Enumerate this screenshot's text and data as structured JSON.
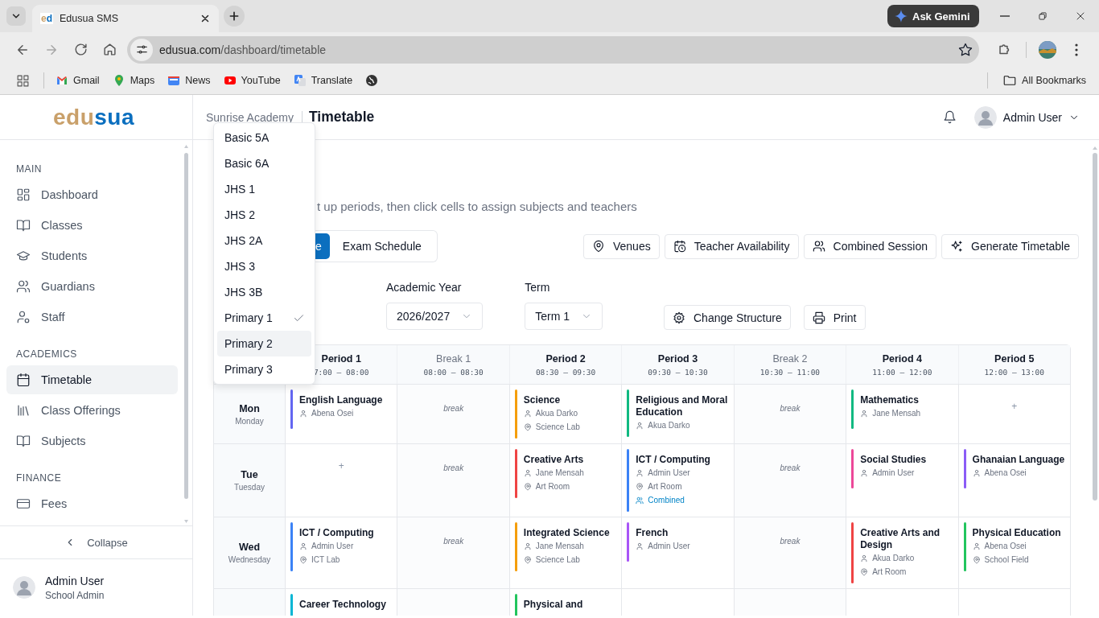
{
  "browser": {
    "tab": {
      "favicon_first": "e",
      "favicon_second": "d",
      "title": "Edusua SMS"
    },
    "ask_gemini": "Ask Gemini",
    "url_host": "edusua.com",
    "url_path": "/dashboard/timetable",
    "bookmarks": [
      "Gmail",
      "Maps",
      "News",
      "YouTube",
      "Translate"
    ],
    "all_bookmarks": "All Bookmarks"
  },
  "sidebar": {
    "logo_first": "edu",
    "logo_second": "sua",
    "sections": [
      {
        "title": "MAIN",
        "items": [
          {
            "label": "Dashboard",
            "selected": false
          },
          {
            "label": "Classes",
            "selected": false
          },
          {
            "label": "Students",
            "selected": false
          },
          {
            "label": "Guardians",
            "selected": false
          },
          {
            "label": "Staff",
            "selected": false
          }
        ]
      },
      {
        "title": "ACADEMICS",
        "items": [
          {
            "label": "Timetable",
            "selected": true
          },
          {
            "label": "Class Offerings",
            "selected": false
          },
          {
            "label": "Subjects",
            "selected": false
          }
        ]
      },
      {
        "title": "FINANCE",
        "items": [
          {
            "label": "Fees",
            "selected": false
          }
        ]
      }
    ],
    "collapse": "Collapse",
    "user": {
      "name": "Admin User",
      "role": "School Admin"
    }
  },
  "header": {
    "school": "Sunrise Academy",
    "page": "Timetable",
    "user": "Admin User"
  },
  "subtitle": "t up periods, then click cells to assign subjects and teachers",
  "view_tabs": [
    {
      "label": "e",
      "selected": true
    },
    {
      "label": "Exam Schedule",
      "selected": false
    }
  ],
  "actions": [
    "Venues",
    "Teacher Availability",
    "Combined Session",
    "Generate Timetable"
  ],
  "filters": [
    {
      "label": "Academic Year",
      "value": "2026/2027"
    },
    {
      "label": "Term",
      "value": "Term 1"
    }
  ],
  "tools": [
    "Change Structure",
    "Print"
  ],
  "class_dropdown": [
    {
      "label": "Basic 5A",
      "checked": false,
      "highlighted": false
    },
    {
      "label": "Basic 6A",
      "checked": false,
      "highlighted": false
    },
    {
      "label": "JHS 1",
      "checked": false,
      "highlighted": false
    },
    {
      "label": "JHS 2",
      "checked": false,
      "highlighted": false
    },
    {
      "label": "JHS 2A",
      "checked": false,
      "highlighted": false
    },
    {
      "label": "JHS 3",
      "checked": false,
      "highlighted": false
    },
    {
      "label": "JHS 3B",
      "checked": false,
      "highlighted": false
    },
    {
      "label": "Primary 1",
      "checked": true,
      "highlighted": false
    },
    {
      "label": "Primary 2",
      "checked": false,
      "highlighted": true
    },
    {
      "label": "Primary 3",
      "checked": false,
      "highlighted": false
    }
  ],
  "timetable": {
    "columns": [
      {
        "kind": "period",
        "name": "Period 1",
        "time": "7:00 – 08:00"
      },
      {
        "kind": "break",
        "name": "Break 1",
        "time": "08:00 – 08:30"
      },
      {
        "kind": "period",
        "name": "Period 2",
        "time": "08:30 – 09:30"
      },
      {
        "kind": "period",
        "name": "Period 3",
        "time": "09:30 – 10:30"
      },
      {
        "kind": "break",
        "name": "Break 2",
        "time": "10:30 – 11:00"
      },
      {
        "kind": "period",
        "name": "Period 4",
        "time": "11:00 – 12:00"
      },
      {
        "kind": "period",
        "name": "Period 5",
        "time": "12:00 – 13:00"
      }
    ],
    "rows": [
      {
        "day": "Mon",
        "day_full": "Monday",
        "cells": [
          {
            "kind": "lesson",
            "subject": "English Language",
            "color": "#6366f1",
            "teacher": "Abena Osei"
          },
          {
            "kind": "break",
            "label": "break"
          },
          {
            "kind": "lesson",
            "subject": "Science",
            "color": "#f59e0b",
            "teacher": "Akua Darko",
            "venue": "Science Lab"
          },
          {
            "kind": "lesson",
            "subject": "Religious and Moral Education",
            "color": "#10b981",
            "teacher": "Akua Darko"
          },
          {
            "kind": "break",
            "label": "break"
          },
          {
            "kind": "lesson",
            "subject": "Mathematics",
            "color": "#10b981",
            "teacher": "Jane Mensah"
          },
          {
            "kind": "empty",
            "label": "+"
          }
        ]
      },
      {
        "day": "Tue",
        "day_full": "Tuesday",
        "cells": [
          {
            "kind": "empty",
            "label": "+"
          },
          {
            "kind": "break",
            "label": "break"
          },
          {
            "kind": "lesson",
            "subject": "Creative Arts",
            "color": "#ef4444",
            "teacher": "Jane Mensah",
            "venue": "Art Room"
          },
          {
            "kind": "lesson",
            "subject": "ICT / Computing",
            "color": "#3b82f6",
            "teacher": "Admin User",
            "venue": "Art Room",
            "combined": "Combined"
          },
          {
            "kind": "break",
            "label": "break"
          },
          {
            "kind": "lesson",
            "subject": "Social Studies",
            "color": "#ec4899",
            "teacher": "Admin User"
          },
          {
            "kind": "lesson",
            "subject": "Ghanaian Language",
            "color": "#8b5cf6",
            "teacher": "Abena Osei"
          }
        ]
      },
      {
        "day": "Wed",
        "day_full": "Wednesday",
        "cells": [
          {
            "kind": "lesson",
            "subject": "ICT / Computing",
            "color": "#3b82f6",
            "teacher": "Admin User",
            "venue": "ICT Lab"
          },
          {
            "kind": "break",
            "label": "break"
          },
          {
            "kind": "lesson",
            "subject": "Integrated Science",
            "color": "#f59e0b",
            "teacher": "Jane Mensah",
            "venue": "Science Lab"
          },
          {
            "kind": "lesson",
            "subject": "French",
            "color": "#a855f7",
            "teacher": "Admin User"
          },
          {
            "kind": "break",
            "label": "break"
          },
          {
            "kind": "lesson",
            "subject": "Creative Arts and Design",
            "color": "#ef4444",
            "teacher": "Akua Darko",
            "venue": "Art Room"
          },
          {
            "kind": "lesson",
            "subject": "Physical Education",
            "color": "#22c55e",
            "teacher": "Abena Osei",
            "venue": "School Field"
          }
        ]
      },
      {
        "cells": [
          {
            "kind": "lesson",
            "subject": "Career Technology",
            "color": "#06b6d4"
          },
          {
            "kind": "break"
          },
          {
            "kind": "lesson",
            "subject": "Physical and",
            "color": "#22c55e"
          },
          {
            "kind": "empty"
          },
          {
            "kind": "break"
          },
          {
            "kind": "empty"
          },
          {
            "kind": "empty"
          }
        ]
      }
    ]
  }
}
